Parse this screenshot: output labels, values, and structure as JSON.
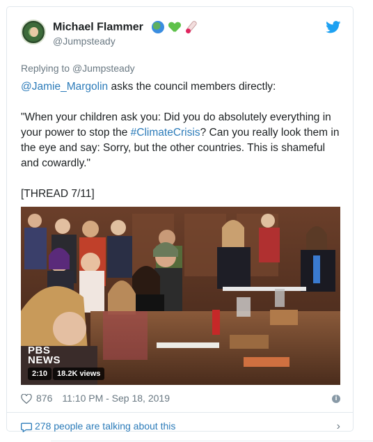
{
  "tweet": {
    "author_name": "Michael Flammer",
    "author_handle": "@Jumpsteady",
    "replying_prefix": "Replying to",
    "replying_handle": "@Jumpsteady",
    "mention": "@Jamie_Margolin",
    "line1_rest": " asks the council members directly:",
    "quote_part1": "\"When your children ask you: Did you do absolutely everything in your power to stop the ",
    "hashtag": "#ClimateCrisis",
    "quote_part2": "? Can you really look them in the eye and say: Sorry, but the other countries. This is shameful and cowardly.\"",
    "thread": "[THREAD 7/11]",
    "video": {
      "watermark_line1": "PBS",
      "watermark_line2": "NEWS",
      "duration": "2:10",
      "views": "18.2K views"
    },
    "likes": "876",
    "timestamp": "11:10 PM - Sep 18, 2019",
    "talking": "278 people are talking about this"
  },
  "colors": {
    "link": "#2b7bb9",
    "muted": "#697882",
    "twitter_blue": "#1da1f2"
  },
  "icons": [
    "twitter-bird-icon",
    "globe-emoji-icon",
    "green-heart-emoji-icon",
    "thermometer-emoji-icon",
    "heart-outline-icon",
    "info-icon",
    "speech-bubble-icon",
    "chevron-right-icon"
  ]
}
